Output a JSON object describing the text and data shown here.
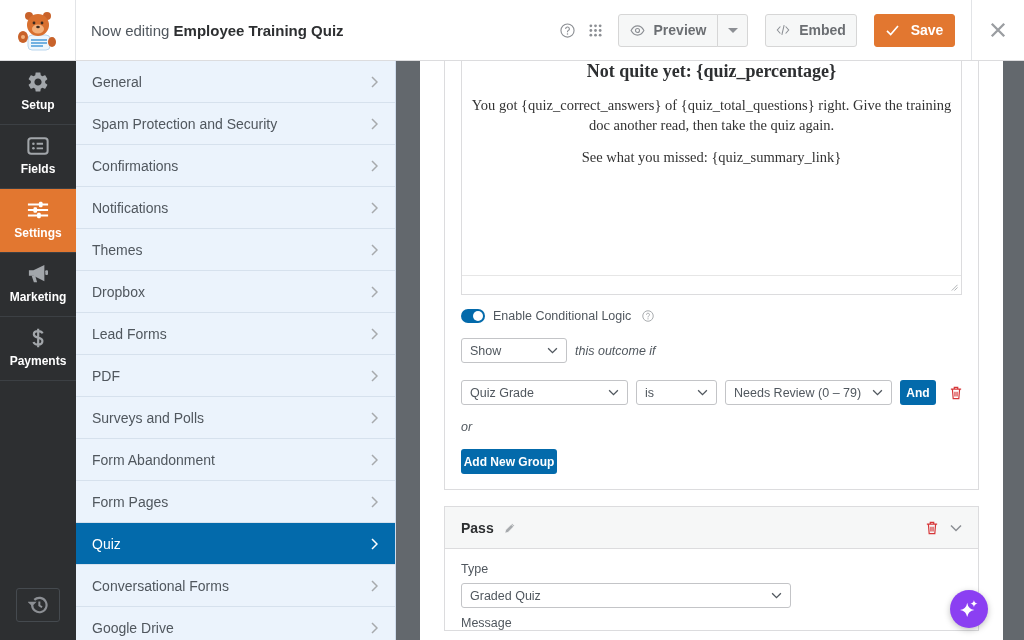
{
  "header": {
    "title": "Now editing **Employee Training Quiz**",
    "preview_label": "Preview",
    "embed_label": "Embed",
    "save_label": "Save"
  },
  "nav": [
    {
      "label": "Setup",
      "selected": false
    },
    {
      "label": "Fields",
      "selected": false
    },
    {
      "label": "Settings",
      "selected": true
    },
    {
      "label": "Marketing",
      "selected": false
    },
    {
      "label": "Payments",
      "selected": false
    }
  ],
  "settings_menu": [
    {
      "label": "General",
      "selected": false
    },
    {
      "label": "Spam Protection and Security",
      "selected": false
    },
    {
      "label": "Confirmations",
      "selected": false
    },
    {
      "label": "Notifications",
      "selected": false
    },
    {
      "label": "Themes",
      "selected": false
    },
    {
      "label": "Dropbox",
      "selected": false
    },
    {
      "label": "Lead Forms",
      "selected": false
    },
    {
      "label": "PDF",
      "selected": false
    },
    {
      "label": "Surveys and Polls",
      "selected": false
    },
    {
      "label": "Form Abandonment",
      "selected": false
    },
    {
      "label": "Form Pages",
      "selected": false
    },
    {
      "label": "Quiz",
      "selected": true
    },
    {
      "label": "Conversational Forms",
      "selected": false
    },
    {
      "label": "Google Drive",
      "selected": false
    }
  ],
  "outcome": {
    "message": {
      "heading": "Not quite yet: {quiz_percentage}",
      "paragraphs": [
        "You got {quiz_correct_answers} of {quiz_total_questions} right. Give the training doc another read, then take the quiz again.",
        "See what you missed: {quiz_summary_link}"
      ]
    },
    "conditional_logic": {
      "label": "Enable Conditional Logic",
      "on": true,
      "action": "Show",
      "action_suffix": "this outcome if",
      "rules": [
        {
          "field": "Quiz Grade",
          "operator": "is",
          "value": "Needs Review (0 – 79)",
          "and_label": "And"
        }
      ],
      "or_label": "or",
      "add_group_label": "Add New Group"
    }
  },
  "pass_outcome": {
    "title": "Pass",
    "type_label": "Type",
    "type_value": "Graded Quiz",
    "message_label": "Message"
  }
}
